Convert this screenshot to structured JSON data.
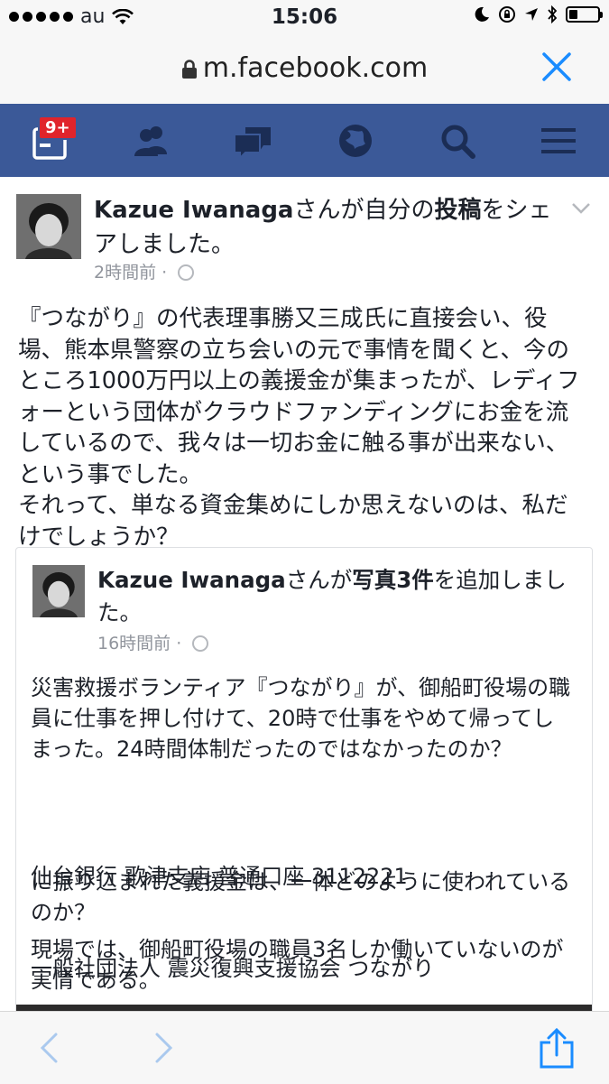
{
  "status_bar": {
    "carrier": "au",
    "time": "15:06",
    "battery_level": 0.3
  },
  "browser": {
    "url": "m.facebook.com",
    "close_icon": "close-icon",
    "lock_icon": "lock-icon"
  },
  "fb_nav": {
    "notification_badge": "9+",
    "items": [
      "feed-icon",
      "friends-icon",
      "messages-icon",
      "globe-icon",
      "search-icon",
      "menu-icon"
    ],
    "color": "#3b5998"
  },
  "post": {
    "author": "Kazue Iwanaga",
    "action_prefix": "さんが自分の",
    "action_bold": "投稿",
    "action_suffix": "をシェアしました。",
    "time": "2時間前",
    "body": "『つながり』の代表理事勝又三成氏に直接会い、役場、熊本県警察の立ち会いの元で事情を聞くと、今のところ1000万円以上の義援金が集まったが、レディフォーという団体がクラウドファンディングにお金を流しているので、我々は一切お金に触る事が出来ない、という事でした。\nそれって、単なる資金集めにしか思えないのは、私だけでしょうか？"
  },
  "shared_post": {
    "author": "Kazue Iwanaga",
    "action_prefix": "さんが",
    "action_bold": "写真3件",
    "action_suffix": "を追加しました。",
    "time": "16時間前",
    "para1": "災害救援ボランティア『つながり』が、御船町役場の職員に仕事を押し付けて、20時で仕事をやめて帰ってしまった。24時間体制だったのではなかったのか？",
    "para2_line1": "仙台銀行 歌津支店 普通口座 3112221",
    "para2_line2": "一般社団法人 震災復興支援協会 つながり",
    "para3": "に振り込まれた義援金は、一体どのように使われているのか？",
    "para4": "現場では、御船町役場の職員3名しか働いていないのが実情である。"
  },
  "toolbar": {
    "items": [
      "back-icon",
      "forward-icon",
      "share-icon"
    ],
    "accent": "#1a8cff"
  }
}
